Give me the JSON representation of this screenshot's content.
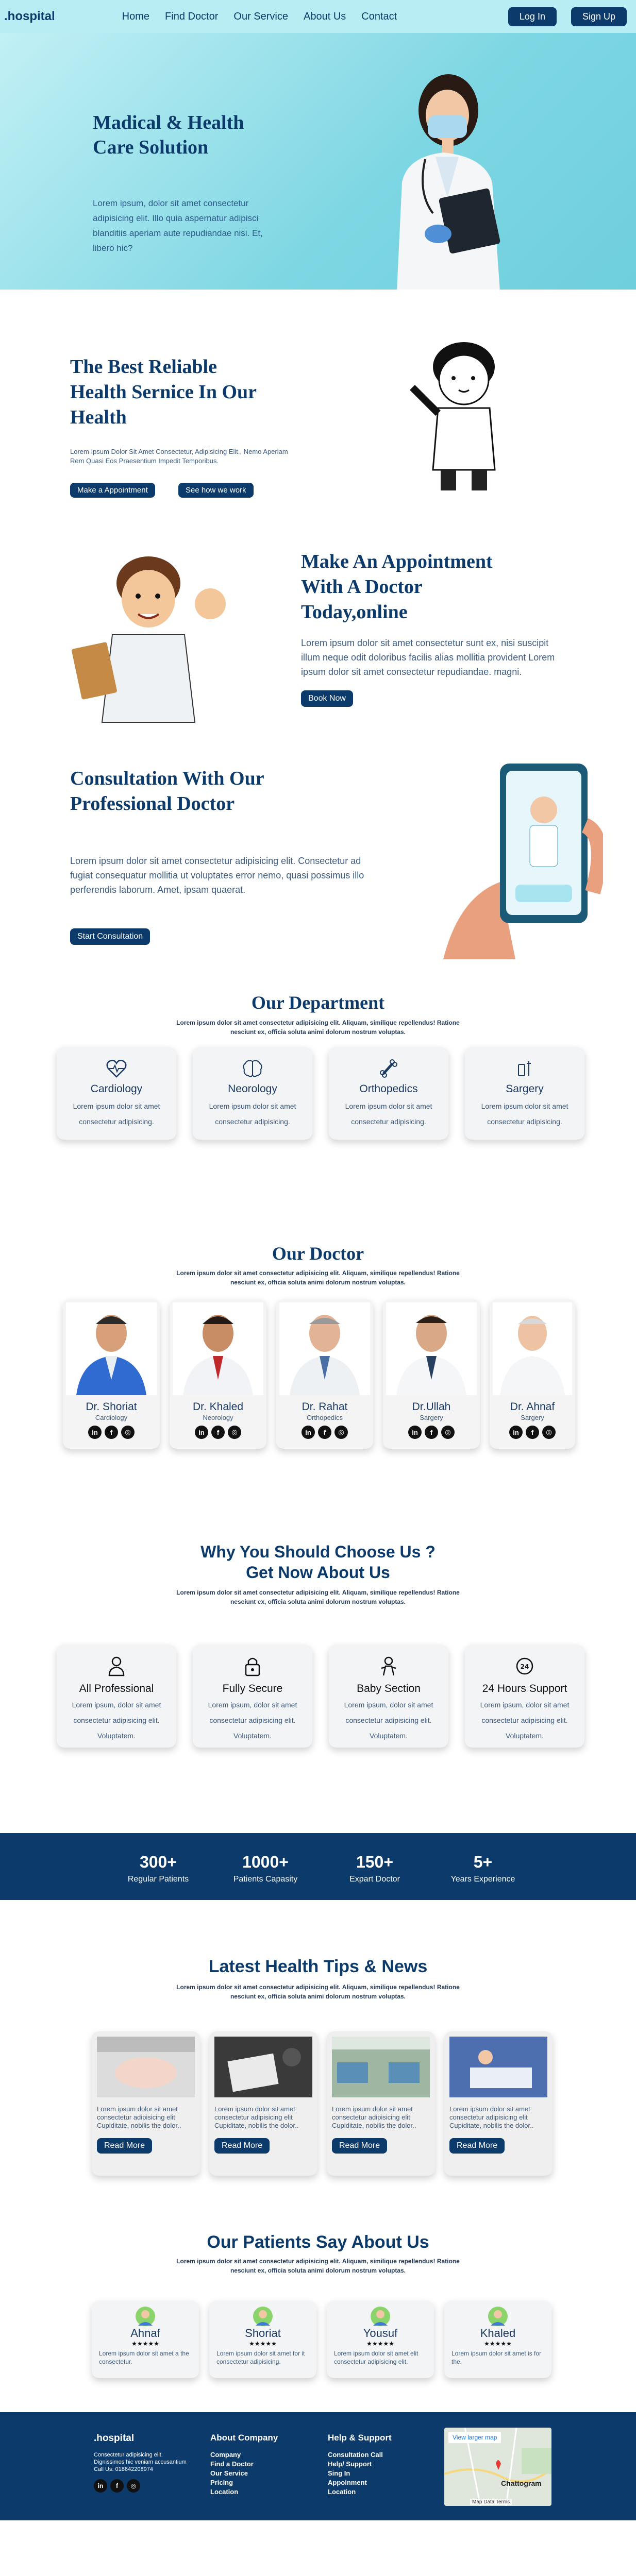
{
  "brand": ".hospital",
  "nav": {
    "items": [
      "Home",
      "Find Doctor",
      "Our Service",
      "About Us",
      "Contact"
    ],
    "login": "Log In",
    "signup": "Sign Up"
  },
  "hero": {
    "title": "Madical & Health Care Solution",
    "text": "Lorem ipsum, dolor sit amet consectetur adipisicing elit. Illo quia aspernatur adipisci blanditiis aperiam aute repudiandae nisi. Et, libero hic?"
  },
  "reliable": {
    "title": "The Best Reliable Health Sernice In Our Health",
    "text": "Lorem Ipsum Dolor Sit Amet Consectetur, Adipisicing Elit., Nemo Aperiam Rem Quasi Eos Praesentium Impedit Temporibus.",
    "btn1": "Make a Appointment",
    "btn2": "See how we work"
  },
  "appointment": {
    "title": "Make An Appointment With A Doctor Today,online",
    "text": "Lorem ipsum dolor sit amet consectetur sunt ex, nisi suscipit illum neque odit doloribus facilis alias mollitia provident Lorem ipsum dolor sit amet consectetur repudiandae. magni.",
    "btn": "Book Now"
  },
  "consult": {
    "title": "Consultation With Our Professional Doctor",
    "text": "Lorem ipsum dolor sit amet consectetur adipisicing elit. Consectetur ad fugiat consequatur mollitia ut voluptates error nemo, quasi possimus illo perferendis laborum. Amet, ipsam quaerat.",
    "btn": "Start Consultation"
  },
  "section_sub": "Lorem ipsum dolor sit amet consectetur adipisicing elit. Aliquam, similique repellendus! Ratione nesciunt ex, officia soluta animi dolorum nostrum voluptas.",
  "departments": {
    "title": "Our Department",
    "items": [
      {
        "name": "Cardiology",
        "desc": "Lorem ipsum dolor sit amet consectetur adipisicing.",
        "icon": "heart-pulse-icon"
      },
      {
        "name": "Neorology",
        "desc": "Lorem ipsum dolor sit amet consectetur adipisicing.",
        "icon": "brain-icon"
      },
      {
        "name": "Orthopedics",
        "desc": "Lorem ipsum dolor sit amet consectetur adipisicing.",
        "icon": "bone-icon"
      },
      {
        "name": "Sargery",
        "desc": "Lorem ipsum dolor sit amet consectetur adipisicing.",
        "icon": "surgery-icon"
      }
    ]
  },
  "doctors": {
    "title": "Our Doctor",
    "items": [
      {
        "name": "Dr. Shoriat",
        "spec": "Cardiology"
      },
      {
        "name": "Dr. Khaled",
        "spec": "Neorology"
      },
      {
        "name": "Dr. Rahat",
        "spec": "Orthopedics"
      },
      {
        "name": "Dr.Ullah",
        "spec": "Sargery"
      },
      {
        "name": "Dr. Ahnaf",
        "spec": "Sargery"
      }
    ],
    "social": [
      "in",
      "f",
      "◎"
    ]
  },
  "why": {
    "title1": "Why You Should Choose Us ?",
    "title2": "Get Now About Us",
    "items": [
      {
        "name": "All Professional",
        "desc": "Lorem ipsum, dolor sit amet consectetur adipisicing elit. Voluptatem.",
        "icon": "doctor-icon"
      },
      {
        "name": "Fully Secure",
        "desc": "Lorem ipsum, dolor sit amet consectetur adipisicing elit. Voluptatem.",
        "icon": "lock-icon"
      },
      {
        "name": "Baby Section",
        "desc": "Lorem ipsum, dolor sit amet consectetur adipisicing elit. Voluptatem.",
        "icon": "baby-icon"
      },
      {
        "name": "24 Hours Support",
        "desc": "Lorem ipsum, dolor sit amet consectetur adipisicing elit. Voluptatem.",
        "icon": "support-24-icon"
      }
    ]
  },
  "stats": [
    {
      "n": "300+",
      "l": "Regular Patients"
    },
    {
      "n": "1000+",
      "l": "Patients Capasity"
    },
    {
      "n": "150+",
      "l": "Expart Doctor"
    },
    {
      "n": "5+",
      "l": "Years Experience"
    }
  ],
  "news": {
    "title": "Latest Health Tips & News",
    "text": "Lorem ipsum dolor sit amet consectetur adipisicing elit Cupiditate, nobilis the dolor..",
    "btn": "Read More"
  },
  "testimonials": {
    "title": "Our Patients Say About Us",
    "items": [
      {
        "name": "Ahnaf",
        "text": "Lorem ipsum dolor sit amet a the consectetur."
      },
      {
        "name": "Shoriat",
        "text": "Lorem ipsum dolor sit amet for it consectetur adipisicing."
      },
      {
        "name": "Yousuf",
        "text": "Lorem ipsum dolor sit amet elit consectetur adipisicing elit."
      },
      {
        "name": "Khaled",
        "text": "Lorem ipsum dolor sit amet is for the."
      }
    ],
    "stars": "★★★★★"
  },
  "footer": {
    "brand": ".hospital",
    "info": [
      "Consectetur adipisicing elit.",
      "Dignissimos hic veniam accusantium",
      "Call Us: 018642208974"
    ],
    "about_title": "About Company",
    "about": [
      "Company",
      "Find a Doctor",
      "Our Service",
      "Pricing",
      "Location"
    ],
    "help_title": "Help & Support",
    "help": [
      "Consultation Call",
      "Help/ Support",
      "Sing In",
      "Appoinment",
      "Location"
    ],
    "map_link": "View larger map",
    "map_label": "Chattogram",
    "map_footer": "Map Data  Terms"
  }
}
